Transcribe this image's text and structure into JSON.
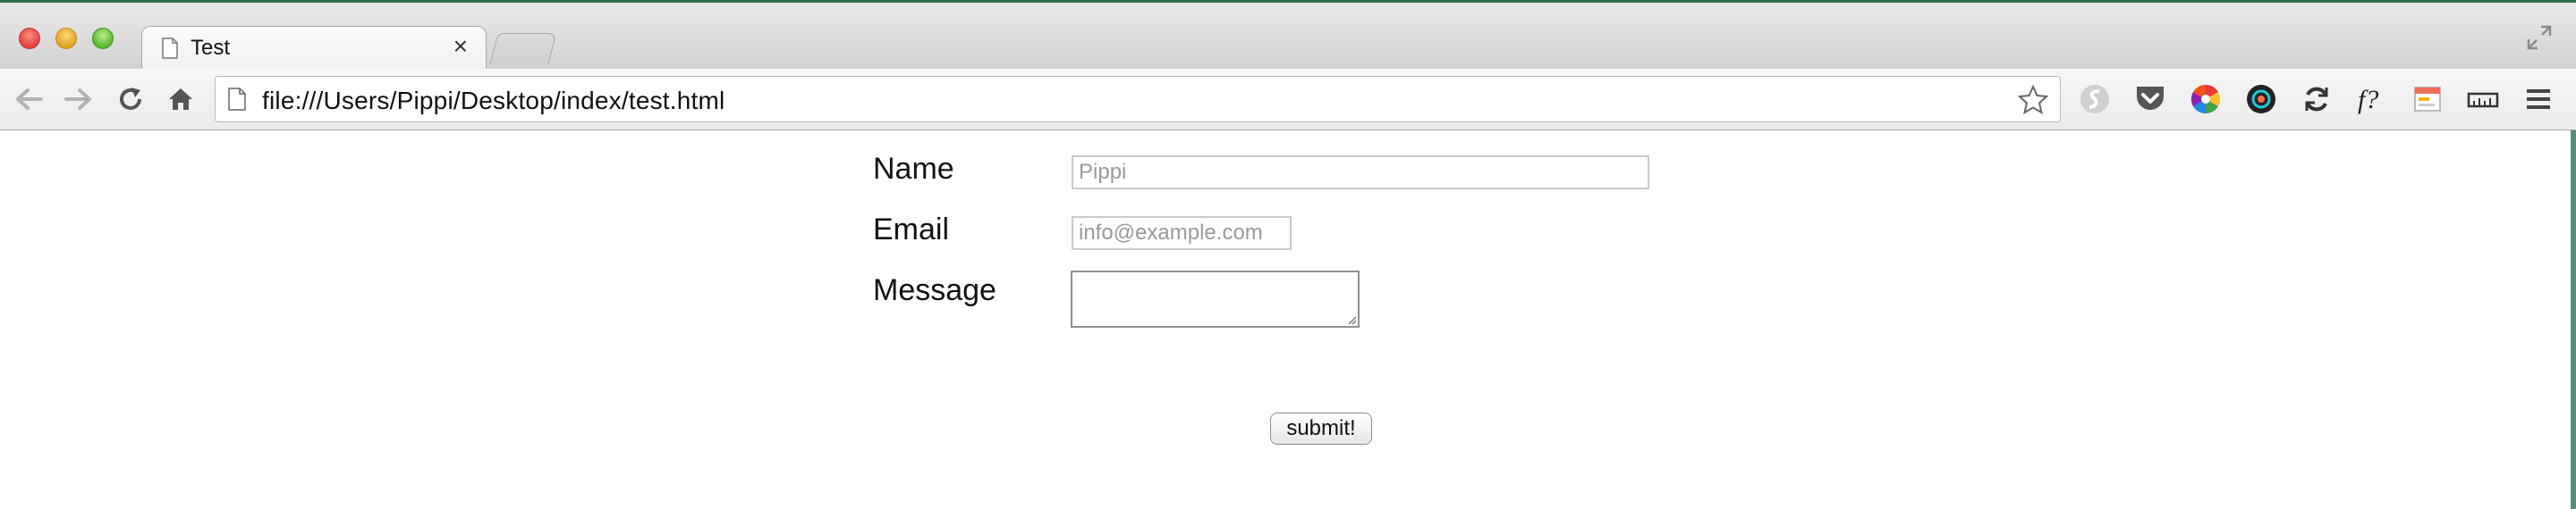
{
  "window": {
    "tab_title": "Test",
    "tab_close": "×"
  },
  "toolbar": {
    "url": "file:///Users/Pippi/Desktop/index/test.html",
    "extensions": [
      "pocket-icon",
      "color-wheel-icon",
      "eye-dropper-icon",
      "sync-icon",
      "font-finder-icon",
      "calendar-icon",
      "ruler-icon",
      "menu-icon"
    ]
  },
  "form": {
    "name_label": "Name",
    "name_placeholder": "Pippi",
    "email_label": "Email",
    "email_placeholder": "info@example.com",
    "message_label": "Message",
    "message_value": "",
    "submit_label": "submit!"
  },
  "colors": {
    "close": "#e0443e",
    "minimize": "#dea123",
    "maximize": "#57b52c"
  }
}
